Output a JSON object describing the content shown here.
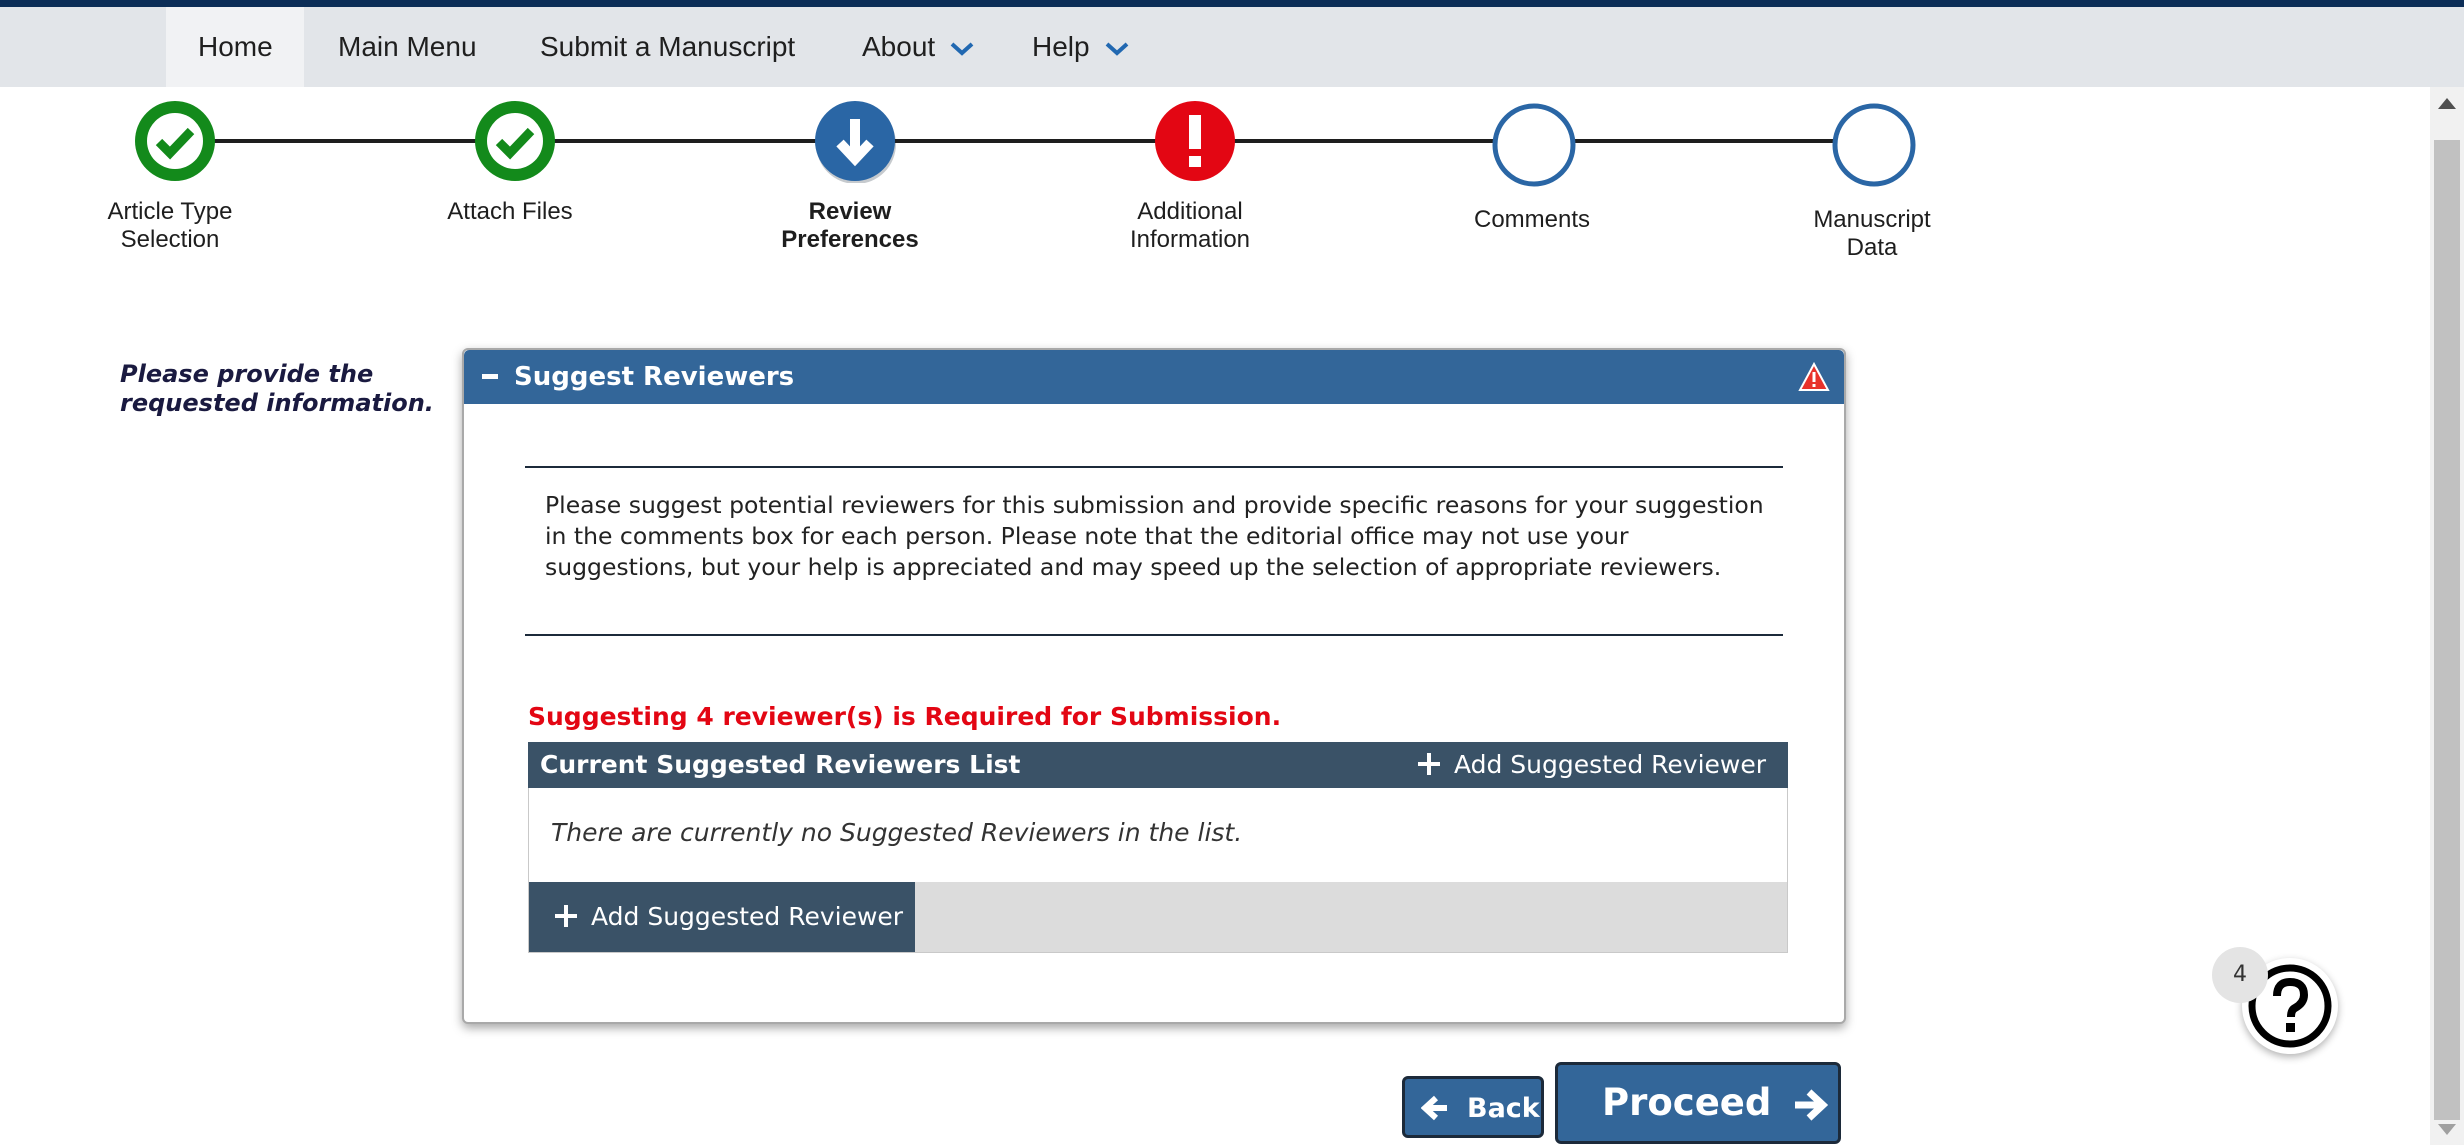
{
  "nav": {
    "items": [
      {
        "label": "Home",
        "active": true
      },
      {
        "label": "Main Menu"
      },
      {
        "label": "Submit a Manuscript"
      },
      {
        "label": "About",
        "has_dropdown": true
      },
      {
        "label": "Help",
        "has_dropdown": true
      }
    ]
  },
  "steps": [
    {
      "label_line1": "Article Type",
      "label_line2": "Selection",
      "status": "complete",
      "icon": "check-icon"
    },
    {
      "label_line1": "Attach Files",
      "label_line2": "",
      "status": "complete",
      "icon": "check-icon"
    },
    {
      "label_line1": "Review",
      "label_line2": "Preferences",
      "status": "current",
      "icon": "arrow-down-icon"
    },
    {
      "label_line1": "Additional",
      "label_line2": "Information",
      "status": "error",
      "icon": "exclamation-icon"
    },
    {
      "label_line1": "Comments",
      "label_line2": "",
      "status": "pending",
      "icon": "empty-circle-icon"
    },
    {
      "label_line1": "Manuscript",
      "label_line2": "Data",
      "status": "pending",
      "icon": "empty-circle-icon"
    }
  ],
  "side_note": {
    "line1": "Please provide the",
    "line2": "requested information."
  },
  "panel": {
    "title": "Suggest Reviewers",
    "instructions": "Please suggest potential reviewers for this submission and provide specific reasons for your suggestion in the comments box for each person. Please note that the editorial office may not use your suggestions, but your help is appreciated and may speed up the selection of appropriate reviewers.",
    "required_message": "Suggesting 4 reviewer(s) is Required for Submission.",
    "list_title": "Current Suggested Reviewers List",
    "add_label": "Add Suggested Reviewer",
    "empty_message": "There are currently no Suggested Reviewers in the list."
  },
  "buttons": {
    "back": "Back",
    "proceed": "Proceed"
  },
  "help": {
    "badge_count": "4",
    "icon": "question-icon"
  },
  "colors": {
    "primary": "#336699",
    "success": "#138a1b",
    "error": "#e30613",
    "dark": "#3a5267",
    "nav_bg": "#e2e5e9"
  }
}
